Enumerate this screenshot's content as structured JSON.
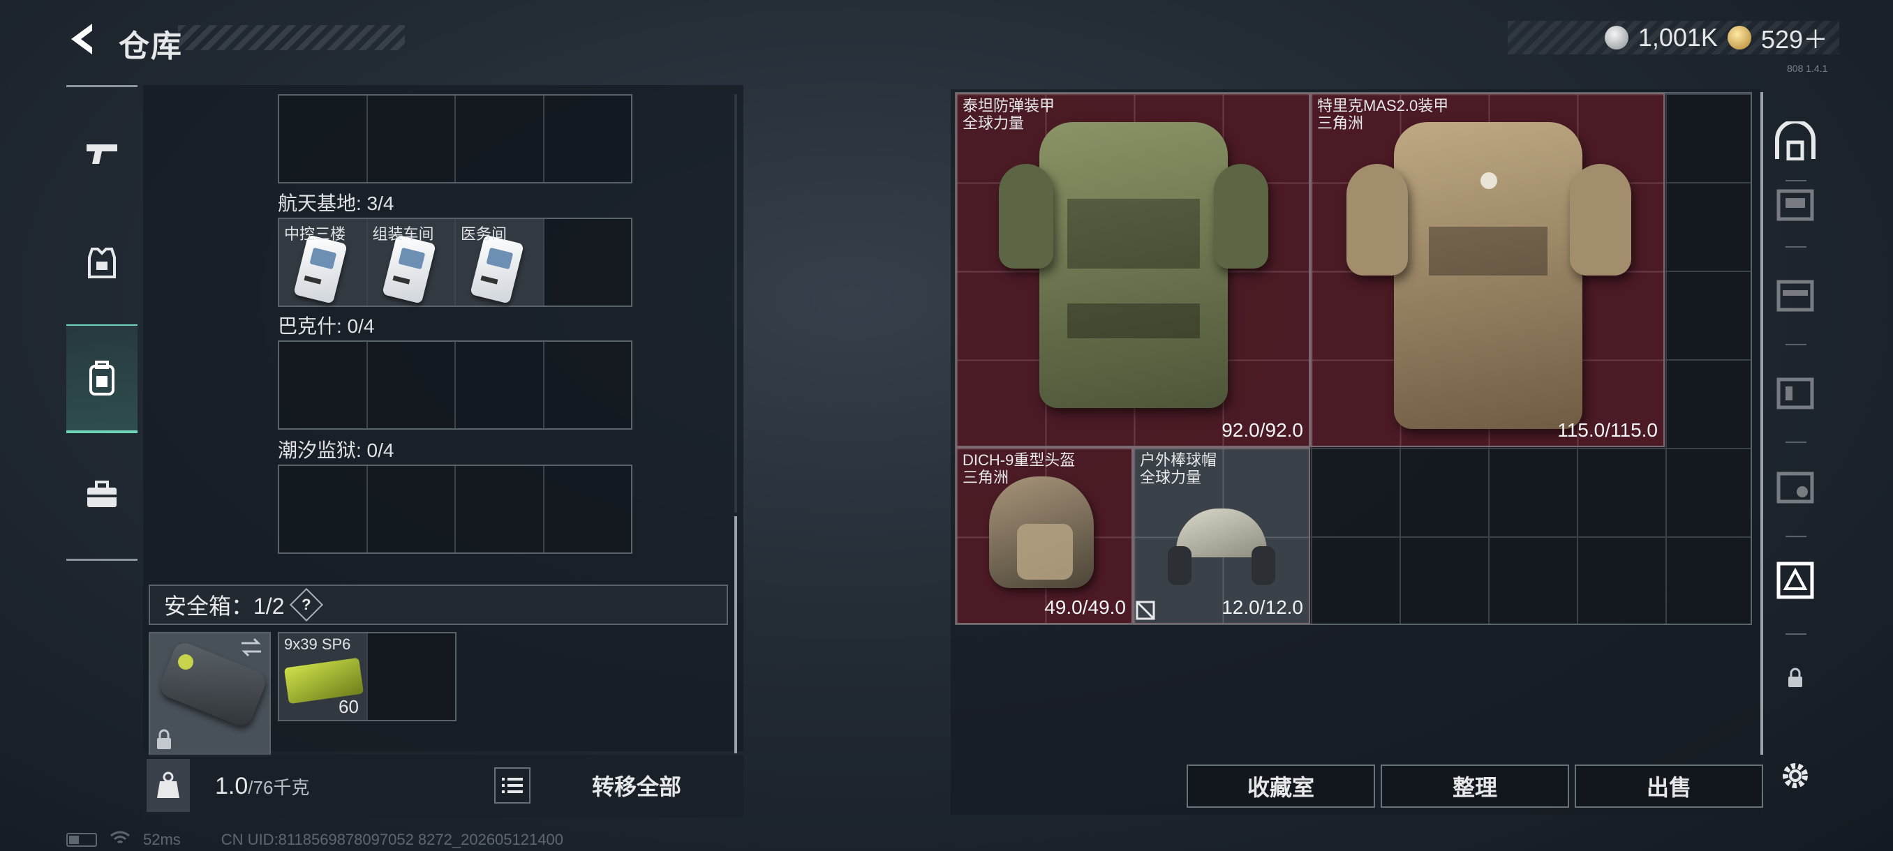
{
  "header": {
    "title": "仓库",
    "currency_primary": "1,001K",
    "currency_secondary": "529＋",
    "version_text": "808 1.4.1"
  },
  "left_nav": {
    "items": [
      {
        "name": "weapons",
        "icon": "pistol-icon"
      },
      {
        "name": "gear",
        "icon": "armor-vest-icon"
      },
      {
        "name": "containers",
        "icon": "backpack-icon",
        "active": true
      },
      {
        "name": "items",
        "icon": "toolbox-icon"
      }
    ]
  },
  "keycards": {
    "sections": [
      {
        "label": "航天基地: 3/4",
        "cards": [
          "中控三楼",
          "组装车间",
          "医务间"
        ]
      },
      {
        "label": "巴克什: 0/4",
        "cards": []
      },
      {
        "label": "潮汐监狱: 0/4",
        "cards": []
      }
    ]
  },
  "safe_box": {
    "label": "安全箱：1/2",
    "help": "?",
    "ammo_name": "9x39 SP6",
    "ammo_count": "60"
  },
  "footer": {
    "weight_value": "1.0",
    "weight_capacity": "/76千克",
    "transfer_all": "转移全部"
  },
  "status_bar": {
    "ping": "52ms",
    "uid": "CN UID:8118569878097052 8272_202605121400"
  },
  "stash_items": [
    {
      "name": "泰坦防弹装甲",
      "source": "全球力量",
      "durability": "92.0/92.0",
      "color": "#6f7a52"
    },
    {
      "name": "特里克MAS2.0装甲",
      "source": "三角洲",
      "durability": "115.0/115.0",
      "color": "#8c7a5e"
    },
    {
      "name": "DICH-9重型头盔",
      "source": "三角洲",
      "durability": "49.0/49.0",
      "color": "#7a6d58"
    },
    {
      "name": "户外棒球帽",
      "source": "全球力量",
      "durability": "12.0/12.0",
      "color": "#a9a89a"
    }
  ],
  "bottom_buttons": {
    "favorites": "收藏室",
    "sort": "整理",
    "sell": "出售"
  },
  "colors": {
    "accent": "#6fd3b7",
    "item_highlight": "#781c28"
  }
}
